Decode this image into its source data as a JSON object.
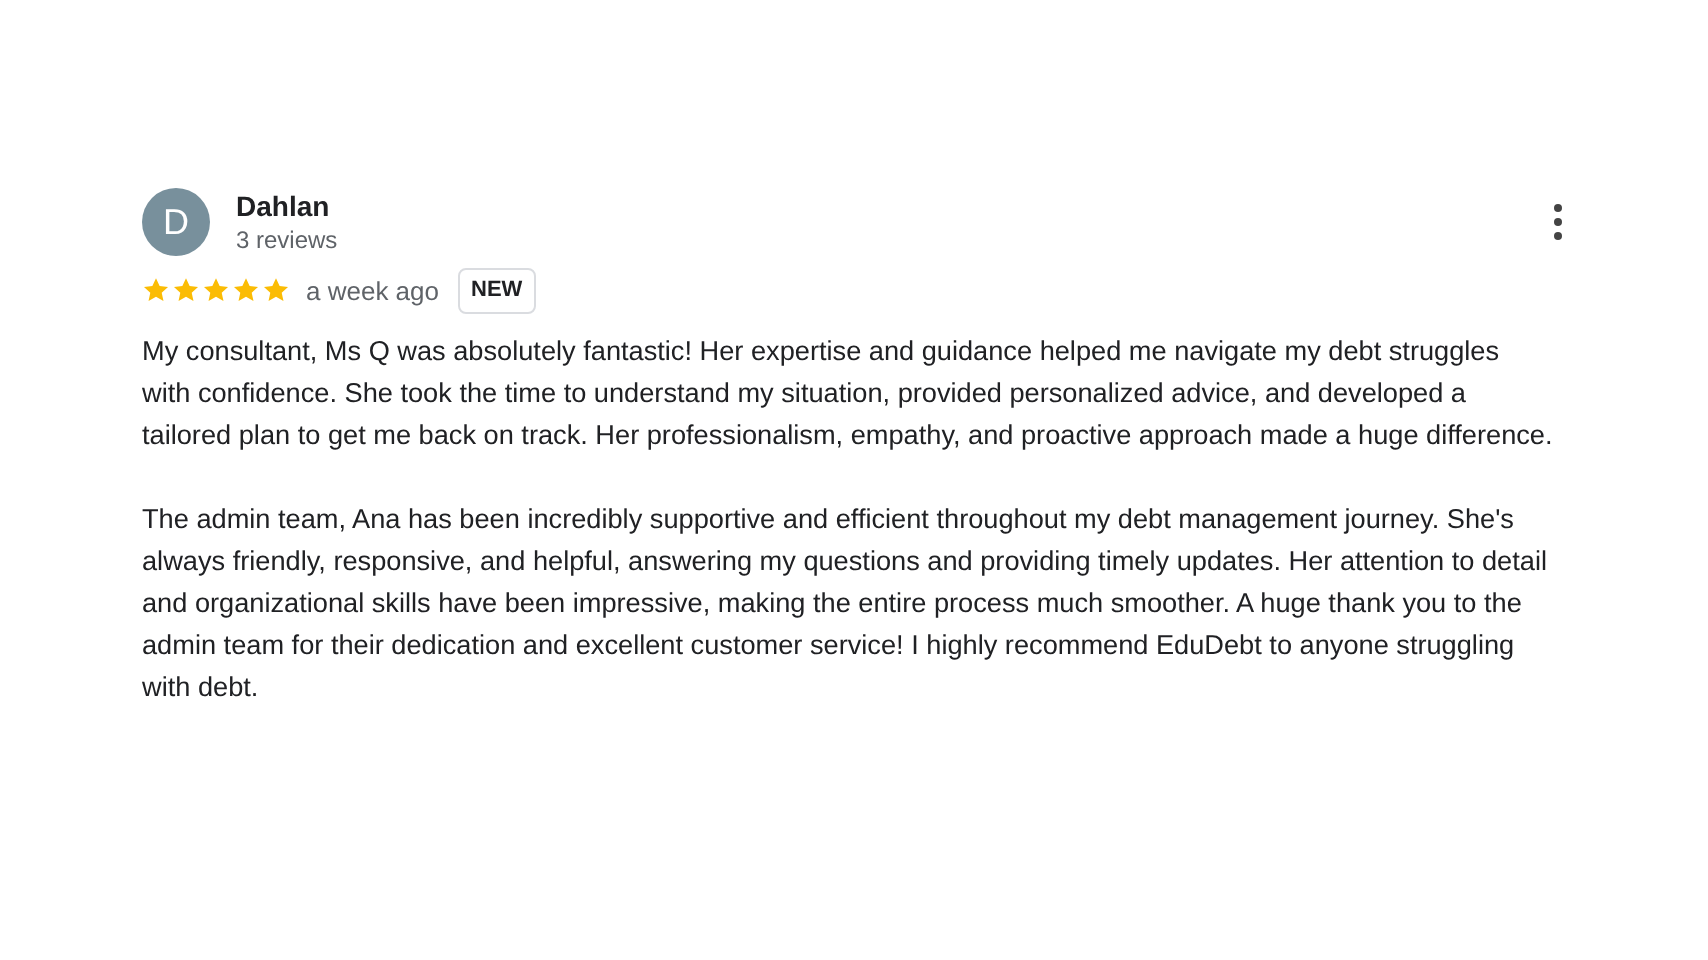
{
  "review": {
    "avatar_letter": "D",
    "author": "Dahlan",
    "review_count": "3 reviews",
    "stars": 5,
    "time": "a week ago",
    "badge": "NEW",
    "paragraphs": [
      "My consultant, Ms Q was absolutely fantastic! Her expertise and guidance helped me navigate my debt struggles with confidence. She took the time to understand my situation, provided personalized advice, and developed a tailored plan to get me back on track. Her professionalism, empathy, and proactive approach made a huge difference.",
      "The admin team, Ana has been incredibly supportive and efficient throughout my debt management journey. She's always friendly, responsive, and helpful, answering my questions and providing timely updates. Her attention to detail and organizational skills have been impressive, making the entire process much smoother. A huge thank you to the admin team for their dedication and excellent customer service! I highly recommend EduDebt to anyone struggling with debt."
    ]
  }
}
